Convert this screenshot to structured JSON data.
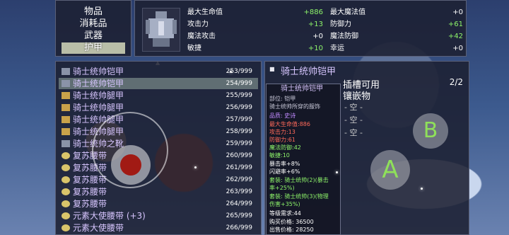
{
  "categories": [
    {
      "label": "物品"
    },
    {
      "label": "消耗品"
    },
    {
      "label": "武器"
    },
    {
      "label": "护甲"
    }
  ],
  "stats": {
    "left": [
      {
        "label": "最大生命值",
        "value": "+886"
      },
      {
        "label": "攻击力",
        "value": "+13"
      },
      {
        "label": "魔法攻击",
        "value": "+0"
      },
      {
        "label": "敏捷",
        "value": "+10"
      }
    ],
    "right": [
      {
        "label": "最大魔法值",
        "value": "+0"
      },
      {
        "label": "防御力",
        "value": "+61"
      },
      {
        "label": "魔法防御",
        "value": "+42"
      },
      {
        "label": "幸运",
        "value": "+0"
      }
    ]
  },
  "items": [
    {
      "name": "骑士统帅铠甲",
      "count": "253/999"
    },
    {
      "name": "骑士统帅铠甲",
      "count": "254/999"
    },
    {
      "name": "骑士统帅腿甲",
      "count": "255/999"
    },
    {
      "name": "骑士统帅腿甲",
      "count": "256/999"
    },
    {
      "name": "骑士统帅腿甲",
      "count": "257/999"
    },
    {
      "name": "骑士统帅腿甲",
      "count": "258/999"
    },
    {
      "name": "骑士统帅之靴",
      "count": "259/999"
    },
    {
      "name": "复苏腰带",
      "count": "260/999"
    },
    {
      "name": "复苏腰带",
      "count": "261/999"
    },
    {
      "name": "复苏腰带",
      "count": "262/999"
    },
    {
      "name": "复苏腰带",
      "count": "263/999"
    },
    {
      "name": "复苏腰带",
      "count": "264/999"
    },
    {
      "name": "元素大使腰带 (+3)",
      "count": "265/999"
    },
    {
      "name": "元素大使腰带",
      "count": "266/999"
    }
  ],
  "detail": {
    "title": "骑士统帅铠甲",
    "slots_label": "插槽可用",
    "inlay_label": "镶嵌物",
    "page": "2/2",
    "slots": [
      "- 空 -",
      "- 空 -",
      "- 空 -"
    ]
  },
  "tooltip": {
    "title": "骑士统帅铠甲",
    "lines": [
      {
        "text": "部位: 铠甲",
        "color": "#c8c8d8"
      },
      {
        "text": "骑士统帅所穿的服饰",
        "color": "#c8c8d8"
      },
      {
        "text": "品质: 史诗",
        "color": "#c08aff"
      },
      {
        "text": "最大生命值:886",
        "color": "#ff6a5a"
      },
      {
        "text": "攻击力:13",
        "color": "#ff6a5a"
      },
      {
        "text": "防御力:61",
        "color": "#ff6a5a"
      },
      {
        "text": "魔法防御:42",
        "color": "#8ef56a"
      },
      {
        "text": "敏捷:10",
        "color": "#8ef56a"
      },
      {
        "text": "暴击率+8%",
        "color": "#ffffff"
      },
      {
        "text": "闪避率+6%",
        "color": "#ffffff"
      },
      {
        "text": "套装: 骑士统帅(2)(暴击",
        "color": "#8ef56a"
      },
      {
        "text": "率+25%)",
        "color": "#8ef56a"
      },
      {
        "text": "套装: 骑士统帅(3)(物理",
        "color": "#8ef56a"
      },
      {
        "text": "伤害+35%)",
        "color": "#8ef56a"
      },
      {
        "text": "等级需求:44",
        "color": "#ffffff"
      },
      {
        "text": "购买价格: 36500",
        "color": "#ffffff"
      },
      {
        "text": "出售价格: 28250",
        "color": "#ffffff"
      }
    ]
  },
  "controls": {
    "a": "A",
    "b": "B"
  }
}
